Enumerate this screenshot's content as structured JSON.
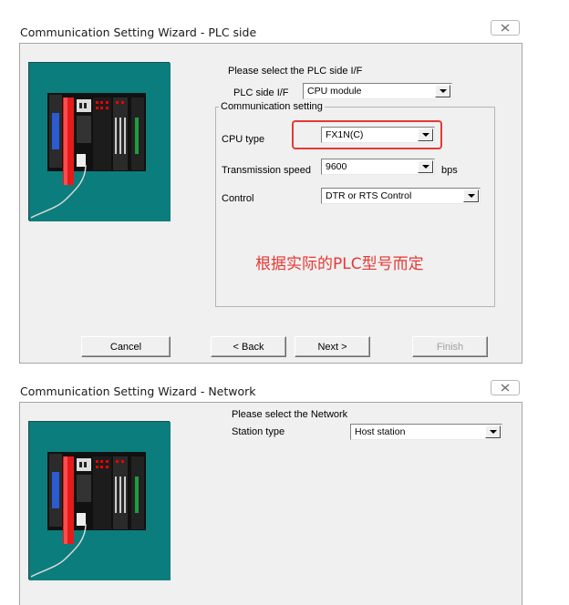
{
  "window1": {
    "title": "Communication Setting Wizard - PLC side",
    "close_glyph": "☒",
    "prompt": "Please select the PLC side I/F",
    "plc_if_label": "PLC side I/F",
    "plc_if_value": "CPU module",
    "group_label": "Communication setting",
    "cpu_type_label": "CPU type",
    "cpu_type_value": "FX1N(C)",
    "speed_label": "Transmission speed",
    "speed_value": "9600",
    "speed_unit": "bps",
    "control_label": "Control",
    "control_value": "DTR or RTS Control",
    "annotation": "根据实际的PLC型号而定",
    "buttons": {
      "cancel": "Cancel",
      "back": "< Back",
      "next": "Next >",
      "finish": "Finish"
    }
  },
  "window2": {
    "title": "Communication Setting Wizard - Network",
    "close_glyph": "☒",
    "prompt": "Please select the Network",
    "station_label": "Station type",
    "station_value": "Host station"
  },
  "colors": {
    "teal_panel": "#0b7d7c",
    "highlight_red": "#e53935"
  },
  "icons": {
    "plc_image": "plc-hardware-illustration",
    "close": "close-icon",
    "dropdown": "dropdown-arrow-icon"
  }
}
